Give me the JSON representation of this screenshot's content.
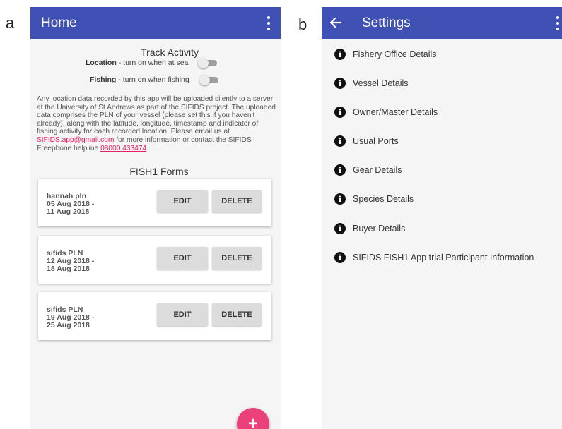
{
  "panel_labels": {
    "a": "a",
    "b": "b"
  },
  "screen_a": {
    "appbar": {
      "title": "Home"
    },
    "track_activity": {
      "title": "Track Activity",
      "location": {
        "label": "Location",
        "desc": " - turn on when at sea",
        "on": false
      },
      "fishing": {
        "label": "Fishing",
        "desc": " - turn on when fishing",
        "on": false
      }
    },
    "info": {
      "text_before_email": "Any location data recorded by this app will be uploaded silently to a server at the University of St Andrews as part of the SIFIDS project. The uploaded data comprises the PLN of your vessel (please set this if you haven't already), along with the latitude, longitude, timestamp and indicator of fishing activity for each recorded location. Please email us at ",
      "email": "SIFIDS.app@gmail.com",
      "text_middle": " for more information or contact the SIFIDS Freephone helpline ",
      "phone": "08000 433474",
      "text_end": "."
    },
    "forms_title": "FISH1 Forms",
    "forms": [
      {
        "name": "hannah pln",
        "from": "05 Aug 2018 -",
        "to": "11 Aug 2018",
        "edit": "EDIT",
        "delete": "DELETE"
      },
      {
        "name": "sifids PLN",
        "from": "12 Aug 2018 -",
        "to": "18 Aug 2018",
        "edit": "EDIT",
        "delete": "DELETE"
      },
      {
        "name": "sifids PLN",
        "from": "19 Aug 2018 -",
        "to": "25 Aug 2018",
        "edit": "EDIT",
        "delete": "DELETE"
      }
    ],
    "fab_label": "+"
  },
  "screen_b": {
    "appbar": {
      "title": "Settings"
    },
    "items": [
      {
        "label": "Fishery Office Details",
        "icon": "info-icon"
      },
      {
        "label": "Vessel Details",
        "icon": "info-icon"
      },
      {
        "label": "Owner/Master Details",
        "icon": "info-icon"
      },
      {
        "label": "Usual Ports",
        "icon": "info-icon"
      },
      {
        "label": "Gear Details",
        "icon": "info-icon"
      },
      {
        "label": "Species Details",
        "icon": "info-icon"
      },
      {
        "label": "Buyer Details",
        "icon": "info-icon"
      },
      {
        "label": "SIFIDS FISH1 App trial Participant Information",
        "icon": "info-icon"
      }
    ]
  },
  "colors": {
    "appbar": "#3f51b5",
    "fab": "#ec407a",
    "link": "#e91e63",
    "background": "#f5f5f5"
  }
}
